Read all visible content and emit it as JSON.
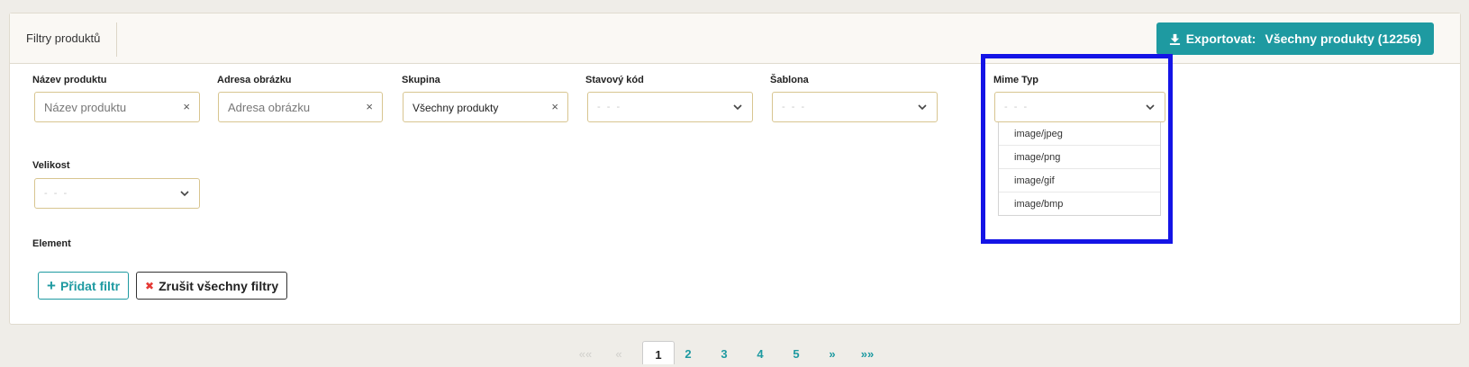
{
  "panel": {
    "title": "Filtry produktů"
  },
  "export": {
    "label": "Exportovat:",
    "value": "Všechny produkty (12256)"
  },
  "filters": {
    "name": {
      "label": "Název produktu",
      "placeholder": "Název produktu",
      "clear": "×"
    },
    "image": {
      "label": "Adresa obrázku",
      "placeholder": "Adresa obrázku",
      "clear": "×"
    },
    "group": {
      "label": "Skupina",
      "value": "Všechny produkty",
      "clear": "×"
    },
    "status": {
      "label": "Stavový kód",
      "value": "- - -"
    },
    "template": {
      "label": "Šablona",
      "value": "- - -"
    },
    "mime": {
      "label": "Mime Typ",
      "value": "- - -",
      "options": [
        "image/jpeg",
        "image/png",
        "image/gif",
        "image/bmp"
      ]
    },
    "size": {
      "label": "Velikost",
      "value": "- - -"
    },
    "element": {
      "label": "Element"
    }
  },
  "actions": {
    "add": {
      "icon": "+",
      "label": "Přidat filtr"
    },
    "clear_all": {
      "icon": "✖",
      "label": "Zrušit všechny filtry"
    }
  },
  "pagination": {
    "first": "««",
    "prev": "«",
    "pages": [
      "1",
      "2",
      "3",
      "4",
      "5"
    ],
    "current": "1",
    "next": "»",
    "last": "»»"
  },
  "colors": {
    "accent": "#1e9aa1",
    "highlight": "#1414e6",
    "field_border": "#d8c590",
    "danger": "#e53935"
  }
}
